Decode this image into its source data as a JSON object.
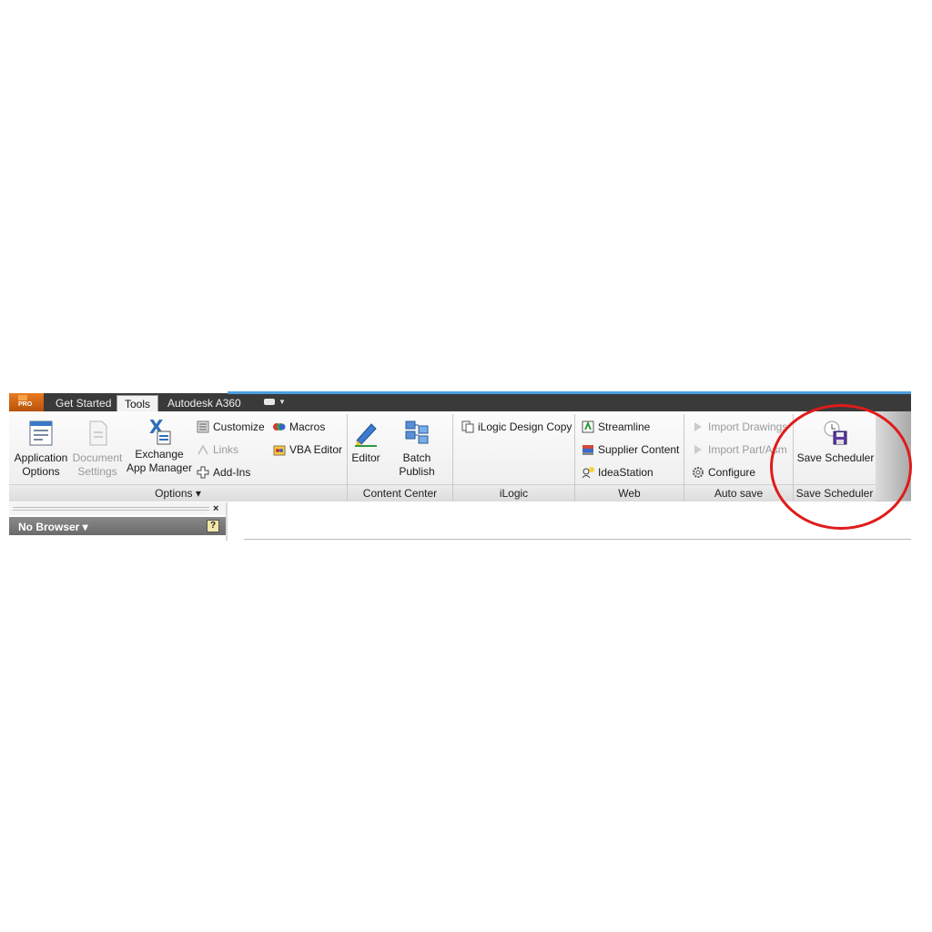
{
  "app": {
    "badge": "PRO"
  },
  "tabs": [
    {
      "label": "Get Started",
      "active": false
    },
    {
      "label": "Tools",
      "active": true
    },
    {
      "label": "Autodesk A360",
      "active": false
    }
  ],
  "ribbon": {
    "options": {
      "footer": "Options ▾",
      "application_options": "Application\nOptions",
      "document_settings": "Document\nSettings",
      "exchange_app_manager": "Exchange\nApp Manager",
      "customize": "Customize",
      "links": "Links",
      "add_ins": "Add-Ins",
      "macros": "Macros",
      "vba_editor": "VBA Editor"
    },
    "content_center": {
      "footer": "Content Center",
      "editor": "Editor",
      "batch_publish": "Batch Publish"
    },
    "ilogic": {
      "footer": "iLogic",
      "design_copy": "iLogic Design Copy"
    },
    "web": {
      "footer": "Web",
      "streamline": "Streamline",
      "supplier_content": "Supplier Content",
      "ideastation": "IdeaStation"
    },
    "auto_save": {
      "footer": "Auto save",
      "import_drawings": "Import Drawings",
      "import_part_asm": "Import Part/Asm",
      "configure": "Configure"
    },
    "save_scheduler": {
      "footer": "Save Scheduler",
      "button": "Save Scheduler"
    }
  },
  "browser": {
    "label": "No Browser ▾",
    "close": "×",
    "help": "?"
  },
  "colors": {
    "tabstrip": "#3a3a3a",
    "accent": "#4aa0e0",
    "annotation": "#e01b1b"
  }
}
